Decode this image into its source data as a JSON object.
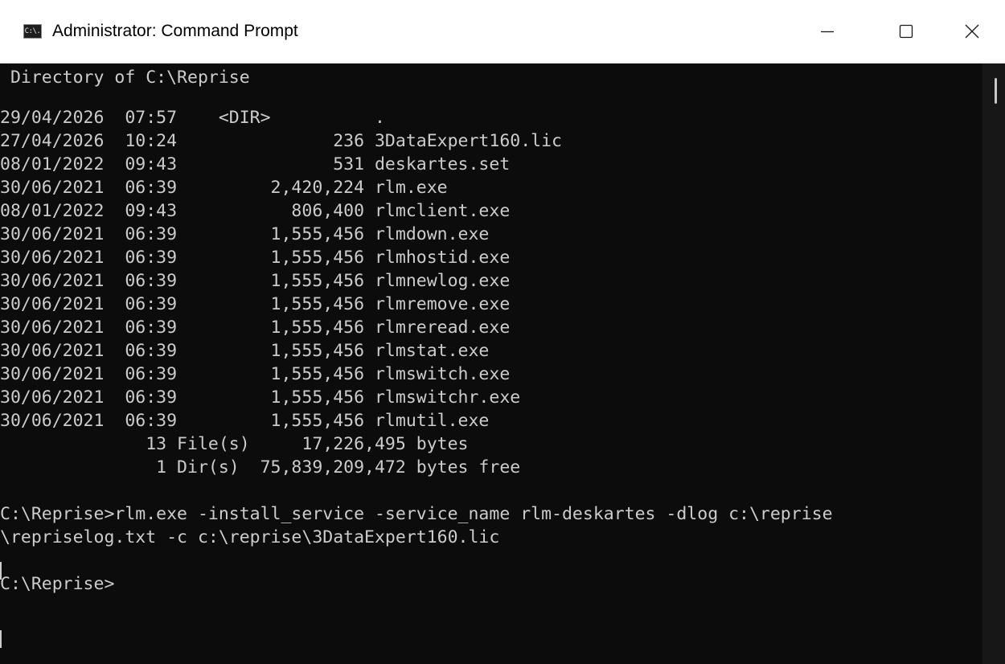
{
  "window": {
    "title": "Administrator: Command Prompt",
    "app_icon_text": "C:\\."
  },
  "console": {
    "lines": [
      " Directory of C:\\Reprise",
      "",
      "29/04/2026  07:57    <DIR>          .",
      "27/04/2026  10:24               236 3DataExpert160.lic",
      "08/01/2022  09:43               531 deskartes.set",
      "30/06/2021  06:39         2,420,224 rlm.exe",
      "08/01/2022  09:43           806,400 rlmclient.exe",
      "30/06/2021  06:39         1,555,456 rlmdown.exe",
      "30/06/2021  06:39         1,555,456 rlmhostid.exe",
      "30/06/2021  06:39         1,555,456 rlmnewlog.exe",
      "30/06/2021  06:39         1,555,456 rlmremove.exe",
      "30/06/2021  06:39         1,555,456 rlmreread.exe",
      "30/06/2021  06:39         1,555,456 rlmstat.exe",
      "30/06/2021  06:39         1,555,456 rlmswitch.exe",
      "30/06/2021  06:39         1,555,456 rlmswitchr.exe",
      "30/06/2021  06:39         1,555,456 rlmutil.exe",
      "              13 File(s)     17,226,495 bytes",
      "               1 Dir(s)  75,839,209,472 bytes free",
      "",
      "C:\\Reprise>rlm.exe -install_service -service_name rlm-deskartes -dlog c:\\reprise",
      "\\repriselog.txt -c c:\\reprise\\3DataExpert160.lic",
      "",
      "C:\\Reprise>"
    ]
  },
  "colors": {
    "console_background": "#0c0c0c",
    "console_text": "#cccccc",
    "titlebar_background": "#ffffff"
  }
}
